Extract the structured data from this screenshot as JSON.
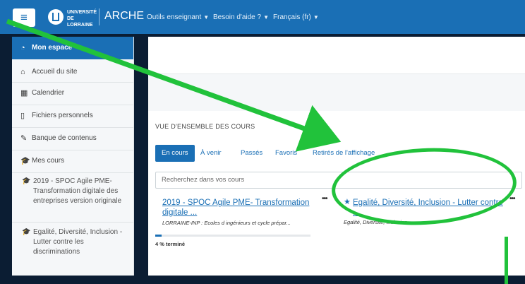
{
  "header": {
    "menu_icon": "≡",
    "university": "UNIVERSITÉ DE LORRAINE",
    "brand": "ARCHE",
    "menus": [
      "Outils enseignant",
      "Besoin d'aide ?",
      "Français (fr)"
    ]
  },
  "nav": {
    "dashboard": "Mon espace",
    "home": "Accueil du site",
    "calendar": "Calendrier",
    "files": "Fichiers personnels",
    "content_bank": "Banque de contenus",
    "my_courses": "Mes cours",
    "course1": "2019 - SPOC Agile PME-Transformation digitale des entreprises version originale",
    "course2": "Egalité, Diversité, Inclusion - Lutter contre les discriminations"
  },
  "overview": {
    "title": "VUE D'ENSEMBLE DES COURS",
    "tabs": [
      "En cours",
      "À venir",
      "Passés",
      "Favoris",
      "Retirés de l'affichage"
    ],
    "search_placeholder": "Recherchez dans vos cours",
    "card1": {
      "title": "2019 - SPOC Agile PME- Transformation digitale ...",
      "subtitle": "LORRAINE-INP : Ecoles d ingénieurs et cycle prépar...",
      "menu": "•••",
      "progress_pct": 4,
      "progress_text": "4 % terminé"
    },
    "card2": {
      "title": "Egalité, Diversité, Inclusion - Lutter contre ...",
      "subtitle": "Egalité, Diversité, Inclusion",
      "menu": "•••",
      "starred": true
    }
  },
  "colors": {
    "primary": "#1a6fb5",
    "annotation": "#21c23b"
  }
}
